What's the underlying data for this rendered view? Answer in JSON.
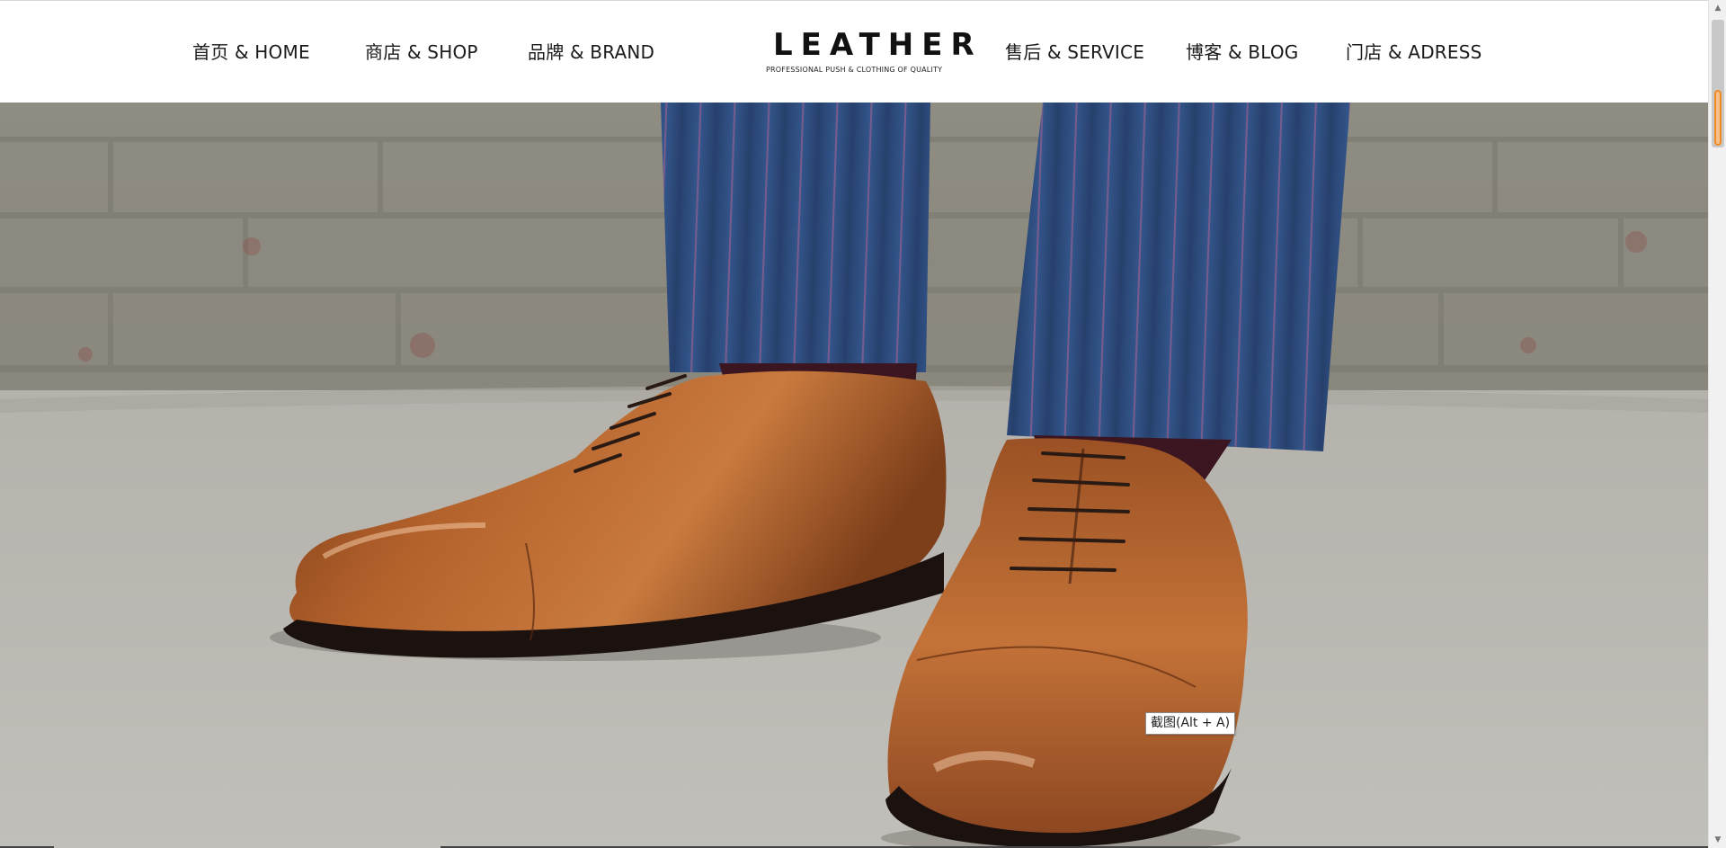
{
  "nav": {
    "left": [
      {
        "label": "首页 & HOME"
      },
      {
        "label": "商店 & SHOP"
      },
      {
        "label": "品牌 & BRAND"
      }
    ],
    "right": [
      {
        "label": "售后 & SERVICE"
      },
      {
        "label": "博客 & BLOG"
      },
      {
        "label": "门店 & ADRESS"
      }
    ]
  },
  "logo": {
    "word": "LEATHER",
    "tagline": "PROFESSIONAL PUSH   &   CLOTHING OF QUALITY"
  },
  "hero": {
    "tooltip": "截图(Alt + A)"
  },
  "colors": {
    "wall": "#8d8b80",
    "ground": "#b9b7b1",
    "trousers": "#2c4a7c",
    "leather": "#a8592a",
    "accent_scroll": "#f08a24"
  }
}
